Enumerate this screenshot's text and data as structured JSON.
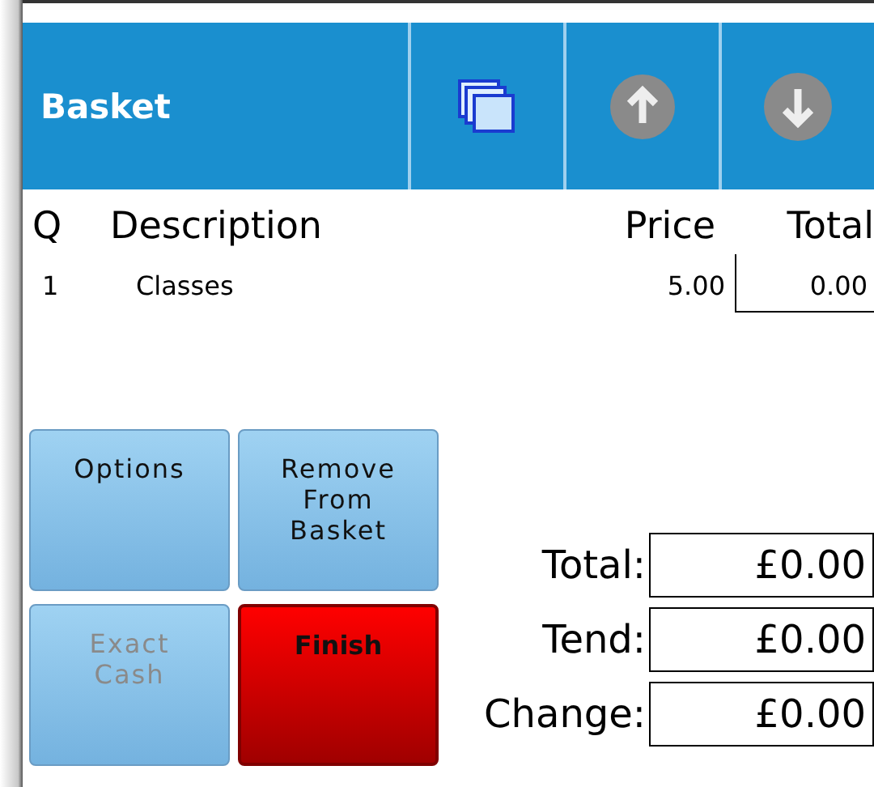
{
  "header": {
    "title": "Basket"
  },
  "columns": [
    "Q",
    "Description",
    "Price",
    "Total"
  ],
  "rows": [
    {
      "q": "1",
      "description": "Classes",
      "price": "5.00",
      "total": "0.00"
    }
  ],
  "buttons": [
    {
      "label": "Options",
      "kind": "normal",
      "disabled": false
    },
    {
      "label": "Remove From Basket",
      "kind": "normal",
      "disabled": false
    },
    {
      "label": "Exact Cash",
      "kind": "normal",
      "disabled": true
    },
    {
      "label": "Finish",
      "kind": "finish",
      "disabled": false
    }
  ],
  "totals": [
    {
      "label": "Total:",
      "value": "£0.00"
    },
    {
      "label": "Tend:",
      "value": "£0.00"
    },
    {
      "label": "Change:",
      "value": "£0.00"
    }
  ]
}
